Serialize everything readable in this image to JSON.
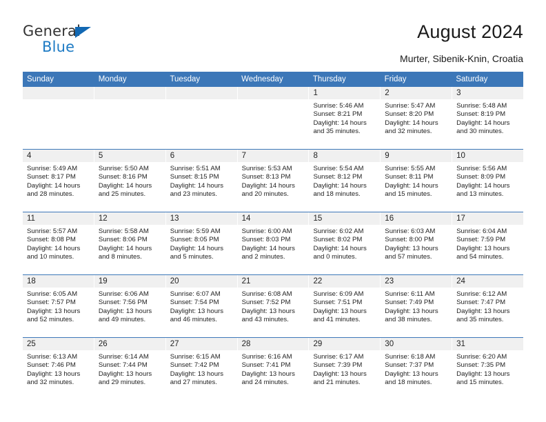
{
  "brand": {
    "name_part1": "General",
    "name_part2": "Blue",
    "accent_color": "#1268B3",
    "blue_text_color": "#1E7BC4"
  },
  "header": {
    "title": "August 2024",
    "subtitle": "Murter, Sibenik-Knin, Croatia"
  },
  "calendar": {
    "header_bg": "#3C77B8",
    "daynum_bg": "#F0F0F0",
    "weekdays": [
      "Sunday",
      "Monday",
      "Tuesday",
      "Wednesday",
      "Thursday",
      "Friday",
      "Saturday"
    ],
    "weeks": [
      [
        {
          "day": "",
          "sunrise": "",
          "sunset": "",
          "daylight": "",
          "empty": true
        },
        {
          "day": "",
          "sunrise": "",
          "sunset": "",
          "daylight": "",
          "empty": true
        },
        {
          "day": "",
          "sunrise": "",
          "sunset": "",
          "daylight": "",
          "empty": true
        },
        {
          "day": "",
          "sunrise": "",
          "sunset": "",
          "daylight": "",
          "empty": true
        },
        {
          "day": "1",
          "sunrise": "Sunrise: 5:46 AM",
          "sunset": "Sunset: 8:21 PM",
          "daylight": "Daylight: 14 hours and 35 minutes."
        },
        {
          "day": "2",
          "sunrise": "Sunrise: 5:47 AM",
          "sunset": "Sunset: 8:20 PM",
          "daylight": "Daylight: 14 hours and 32 minutes."
        },
        {
          "day": "3",
          "sunrise": "Sunrise: 5:48 AM",
          "sunset": "Sunset: 8:19 PM",
          "daylight": "Daylight: 14 hours and 30 minutes."
        }
      ],
      [
        {
          "day": "4",
          "sunrise": "Sunrise: 5:49 AM",
          "sunset": "Sunset: 8:17 PM",
          "daylight": "Daylight: 14 hours and 28 minutes."
        },
        {
          "day": "5",
          "sunrise": "Sunrise: 5:50 AM",
          "sunset": "Sunset: 8:16 PM",
          "daylight": "Daylight: 14 hours and 25 minutes."
        },
        {
          "day": "6",
          "sunrise": "Sunrise: 5:51 AM",
          "sunset": "Sunset: 8:15 PM",
          "daylight": "Daylight: 14 hours and 23 minutes."
        },
        {
          "day": "7",
          "sunrise": "Sunrise: 5:53 AM",
          "sunset": "Sunset: 8:13 PM",
          "daylight": "Daylight: 14 hours and 20 minutes."
        },
        {
          "day": "8",
          "sunrise": "Sunrise: 5:54 AM",
          "sunset": "Sunset: 8:12 PM",
          "daylight": "Daylight: 14 hours and 18 minutes."
        },
        {
          "day": "9",
          "sunrise": "Sunrise: 5:55 AM",
          "sunset": "Sunset: 8:11 PM",
          "daylight": "Daylight: 14 hours and 15 minutes."
        },
        {
          "day": "10",
          "sunrise": "Sunrise: 5:56 AM",
          "sunset": "Sunset: 8:09 PM",
          "daylight": "Daylight: 14 hours and 13 minutes."
        }
      ],
      [
        {
          "day": "11",
          "sunrise": "Sunrise: 5:57 AM",
          "sunset": "Sunset: 8:08 PM",
          "daylight": "Daylight: 14 hours and 10 minutes."
        },
        {
          "day": "12",
          "sunrise": "Sunrise: 5:58 AM",
          "sunset": "Sunset: 8:06 PM",
          "daylight": "Daylight: 14 hours and 8 minutes."
        },
        {
          "day": "13",
          "sunrise": "Sunrise: 5:59 AM",
          "sunset": "Sunset: 8:05 PM",
          "daylight": "Daylight: 14 hours and 5 minutes."
        },
        {
          "day": "14",
          "sunrise": "Sunrise: 6:00 AM",
          "sunset": "Sunset: 8:03 PM",
          "daylight": "Daylight: 14 hours and 2 minutes."
        },
        {
          "day": "15",
          "sunrise": "Sunrise: 6:02 AM",
          "sunset": "Sunset: 8:02 PM",
          "daylight": "Daylight: 14 hours and 0 minutes."
        },
        {
          "day": "16",
          "sunrise": "Sunrise: 6:03 AM",
          "sunset": "Sunset: 8:00 PM",
          "daylight": "Daylight: 13 hours and 57 minutes."
        },
        {
          "day": "17",
          "sunrise": "Sunrise: 6:04 AM",
          "sunset": "Sunset: 7:59 PM",
          "daylight": "Daylight: 13 hours and 54 minutes."
        }
      ],
      [
        {
          "day": "18",
          "sunrise": "Sunrise: 6:05 AM",
          "sunset": "Sunset: 7:57 PM",
          "daylight": "Daylight: 13 hours and 52 minutes."
        },
        {
          "day": "19",
          "sunrise": "Sunrise: 6:06 AM",
          "sunset": "Sunset: 7:56 PM",
          "daylight": "Daylight: 13 hours and 49 minutes."
        },
        {
          "day": "20",
          "sunrise": "Sunrise: 6:07 AM",
          "sunset": "Sunset: 7:54 PM",
          "daylight": "Daylight: 13 hours and 46 minutes."
        },
        {
          "day": "21",
          "sunrise": "Sunrise: 6:08 AM",
          "sunset": "Sunset: 7:52 PM",
          "daylight": "Daylight: 13 hours and 43 minutes."
        },
        {
          "day": "22",
          "sunrise": "Sunrise: 6:09 AM",
          "sunset": "Sunset: 7:51 PM",
          "daylight": "Daylight: 13 hours and 41 minutes."
        },
        {
          "day": "23",
          "sunrise": "Sunrise: 6:11 AM",
          "sunset": "Sunset: 7:49 PM",
          "daylight": "Daylight: 13 hours and 38 minutes."
        },
        {
          "day": "24",
          "sunrise": "Sunrise: 6:12 AM",
          "sunset": "Sunset: 7:47 PM",
          "daylight": "Daylight: 13 hours and 35 minutes."
        }
      ],
      [
        {
          "day": "25",
          "sunrise": "Sunrise: 6:13 AM",
          "sunset": "Sunset: 7:46 PM",
          "daylight": "Daylight: 13 hours and 32 minutes."
        },
        {
          "day": "26",
          "sunrise": "Sunrise: 6:14 AM",
          "sunset": "Sunset: 7:44 PM",
          "daylight": "Daylight: 13 hours and 29 minutes."
        },
        {
          "day": "27",
          "sunrise": "Sunrise: 6:15 AM",
          "sunset": "Sunset: 7:42 PM",
          "daylight": "Daylight: 13 hours and 27 minutes."
        },
        {
          "day": "28",
          "sunrise": "Sunrise: 6:16 AM",
          "sunset": "Sunset: 7:41 PM",
          "daylight": "Daylight: 13 hours and 24 minutes."
        },
        {
          "day": "29",
          "sunrise": "Sunrise: 6:17 AM",
          "sunset": "Sunset: 7:39 PM",
          "daylight": "Daylight: 13 hours and 21 minutes."
        },
        {
          "day": "30",
          "sunrise": "Sunrise: 6:18 AM",
          "sunset": "Sunset: 7:37 PM",
          "daylight": "Daylight: 13 hours and 18 minutes."
        },
        {
          "day": "31",
          "sunrise": "Sunrise: 6:20 AM",
          "sunset": "Sunset: 7:35 PM",
          "daylight": "Daylight: 13 hours and 15 minutes."
        }
      ]
    ]
  }
}
